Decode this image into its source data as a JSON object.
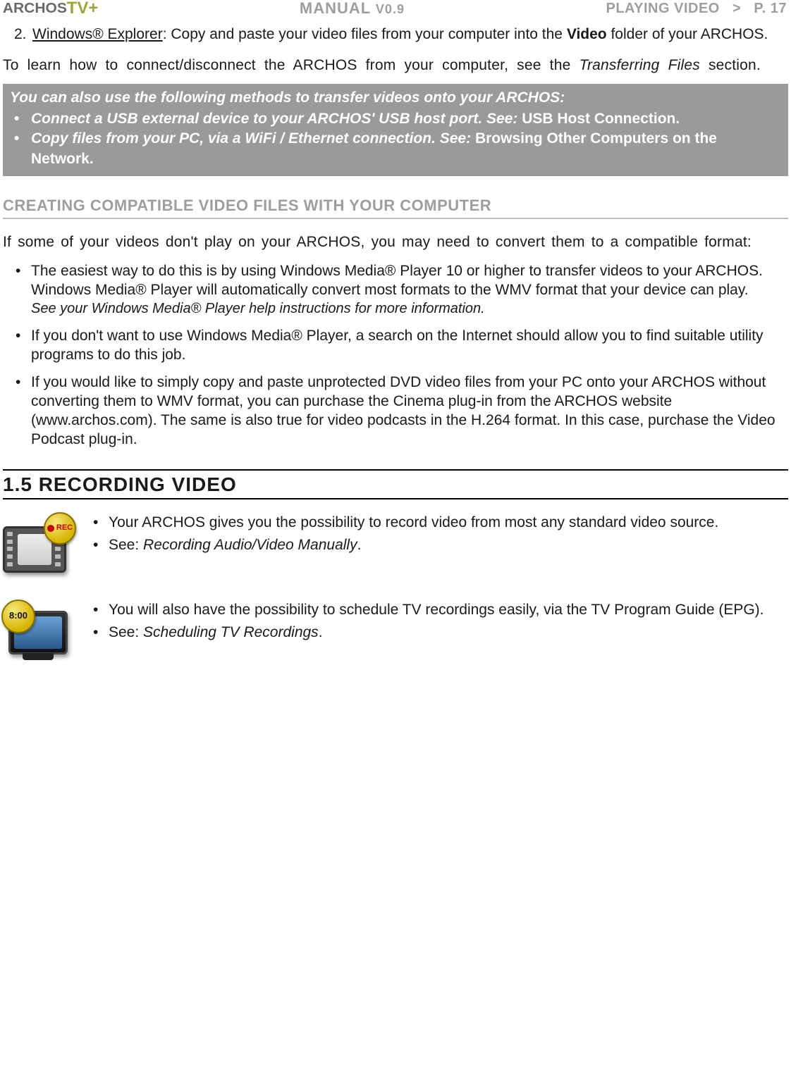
{
  "header": {
    "logo_brand": "ARCHOS",
    "logo_suffix": "TV+",
    "center_label": "MANUAL",
    "center_version": "V0.9",
    "chapter": "PLAYING VIDEO",
    "separator": ">",
    "page": "P. 17"
  },
  "step2": {
    "num": "2.",
    "link": "Windows® Explorer",
    "after_link": ": Copy and paste your video files from your computer into the ",
    "bold": "Video",
    "tail": " folder of your ARCHOS."
  },
  "transfer_para": {
    "before_italic": "To learn how to connect/disconnect the ARCHOS from your computer, see the ",
    "italic": "Transferring Files",
    "after_italic": " section."
  },
  "graybox": {
    "lead": "You can also use the following methods to transfer videos onto your ARCHOS:",
    "item1_pre": "Connect a USB external device to your ARCHOS' USB host port. See: ",
    "item1_bold": "USB Host Connection",
    "item1_post": ".",
    "item2_pre": "Copy files from your PC, via a WiFi / Ethernet connection. See: ",
    "item2_bold": "Browsing Other Computers on the Network",
    "item2_post": "."
  },
  "subheading": "CREATING COMPATIBLE VIDEO FILES WITH YOUR COMPUTER",
  "compat_para": "If some of your videos don't play on your ARCHOS, you may need to convert them to a compatible format:",
  "compat_bullets": {
    "b1_main": "The easiest way to do this is by using Windows Media® Player 10 or higher to transfer videos to your ARCHOS. Windows Media® Player will automatically convert most formats to the WMV format that your device can play.",
    "b1_italic": "See your Windows Media® Player help instructions for more information.",
    "b2": "If you don't want to use Windows Media® Player, a search on the Internet should allow you to find suitable utility programs to do this job.",
    "b3": "If you would like to simply copy and paste unprotected DVD video files from your PC onto your ARCHOS without converting them to WMV format, you can purchase the Cinema plug-in from the ARCHOS website (www.archos.com). The same is also true for video podcasts in the H.264 format. In this case, purchase the Video Podcast plug-in."
  },
  "major_heading": "1.5  RECORDING VIDEO",
  "rec_block": {
    "b1": "Your ARCHOS gives you the possibility to record video from most any standard video source.",
    "b2_pre": "See: ",
    "b2_italic": "Recording Audio/Video Manually",
    "b2_post": "."
  },
  "sched_block": {
    "b1": "You will also have the possibility to schedule TV recordings easily, via the TV Program Guide (EPG).",
    "b2_pre": "See: ",
    "b2_italic": "Scheduling TV Recordings",
    "b2_post": "."
  },
  "icons": {
    "rec_label": "REC",
    "time_label": "8:00"
  }
}
